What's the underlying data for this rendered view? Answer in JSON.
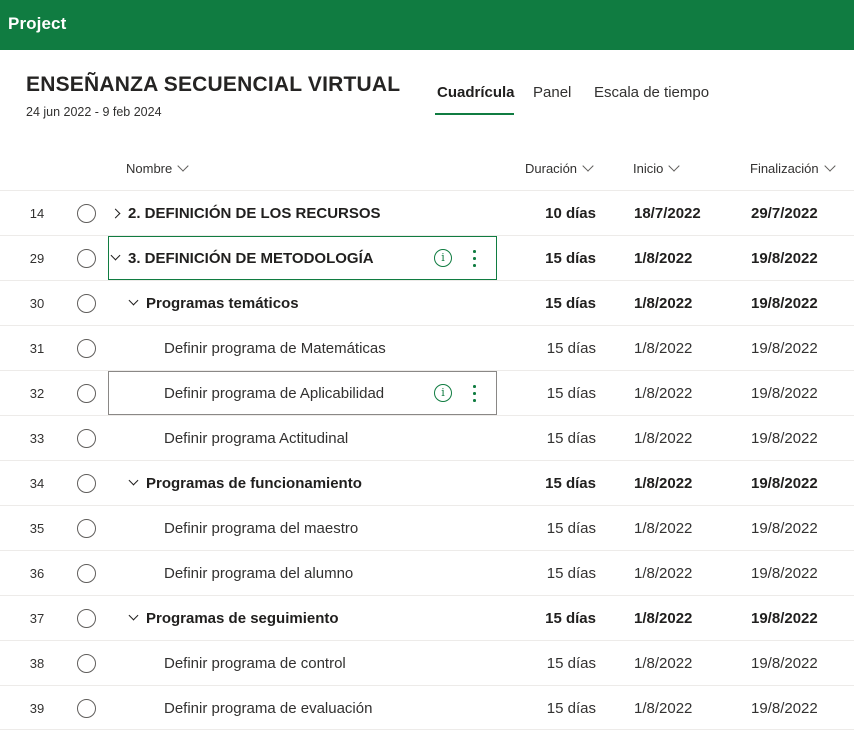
{
  "app": {
    "title": "Project"
  },
  "project": {
    "title": "ENSEÑANZA SECUENCIAL VIRTUAL",
    "dates": "24 jun 2022 - 9 feb 2024"
  },
  "tabs": [
    {
      "label": "Cuadrícula",
      "active": true
    },
    {
      "label": "Panel",
      "active": false
    },
    {
      "label": "Escala de tiempo",
      "active": false
    }
  ],
  "columns": {
    "name": "Nombre",
    "duration": "Duración",
    "start": "Inicio",
    "finish": "Finalización"
  },
  "rows": [
    {
      "num": "14",
      "name": "2. DEFINICIÓN DE LOS RECURSOS",
      "duration": "10 días",
      "start": "18/7/2022",
      "finish": "29/7/2022",
      "bold": true,
      "level": 0,
      "toggle": "collapsed",
      "selected": false
    },
    {
      "num": "29",
      "name": "3. DEFINICIÓN DE METODOLOGÍA",
      "duration": "15 días",
      "start": "1/8/2022",
      "finish": "19/8/2022",
      "bold": true,
      "level": 0,
      "toggle": "expanded",
      "selected": "green"
    },
    {
      "num": "30",
      "name": "Programas temáticos",
      "duration": "15 días",
      "start": "1/8/2022",
      "finish": "19/8/2022",
      "bold": true,
      "level": 1,
      "toggle": "expanded",
      "selected": false
    },
    {
      "num": "31",
      "name": "Definir programa de Matemáticas",
      "duration": "15 días",
      "start": "1/8/2022",
      "finish": "19/8/2022",
      "bold": false,
      "level": 2,
      "toggle": null,
      "selected": false
    },
    {
      "num": "32",
      "name": "Definir programa de Aplicabilidad",
      "duration": "15 días",
      "start": "1/8/2022",
      "finish": "19/8/2022",
      "bold": false,
      "level": 2,
      "toggle": null,
      "selected": "gray"
    },
    {
      "num": "33",
      "name": "Definir programa Actitudinal",
      "duration": "15 días",
      "start": "1/8/2022",
      "finish": "19/8/2022",
      "bold": false,
      "level": 2,
      "toggle": null,
      "selected": false
    },
    {
      "num": "34",
      "name": "Programas de funcionamiento",
      "duration": "15 días",
      "start": "1/8/2022",
      "finish": "19/8/2022",
      "bold": true,
      "level": 1,
      "toggle": "expanded",
      "selected": false
    },
    {
      "num": "35",
      "name": "Definir programa del maestro",
      "duration": "15 días",
      "start": "1/8/2022",
      "finish": "19/8/2022",
      "bold": false,
      "level": 2,
      "toggle": null,
      "selected": false
    },
    {
      "num": "36",
      "name": "Definir programa del alumno",
      "duration": "15 días",
      "start": "1/8/2022",
      "finish": "19/8/2022",
      "bold": false,
      "level": 2,
      "toggle": null,
      "selected": false
    },
    {
      "num": "37",
      "name": "Programas de seguimiento",
      "duration": "15 días",
      "start": "1/8/2022",
      "finish": "19/8/2022",
      "bold": true,
      "level": 1,
      "toggle": "expanded",
      "selected": false
    },
    {
      "num": "38",
      "name": "Definir programa de control",
      "duration": "15 días",
      "start": "1/8/2022",
      "finish": "19/8/2022",
      "bold": false,
      "level": 2,
      "toggle": null,
      "selected": false
    },
    {
      "num": "39",
      "name": "Definir programa de evaluación",
      "duration": "15 días",
      "start": "1/8/2022",
      "finish": "19/8/2022",
      "bold": false,
      "level": 2,
      "toggle": null,
      "selected": false
    }
  ],
  "icons": {
    "info": "info-icon",
    "more": "more-vertical-icon",
    "complete": "circle-check-icon",
    "sort": "chevron-down-icon"
  },
  "colors": {
    "brand": "#107c41",
    "text": "#252423",
    "divider": "#edebe9"
  }
}
